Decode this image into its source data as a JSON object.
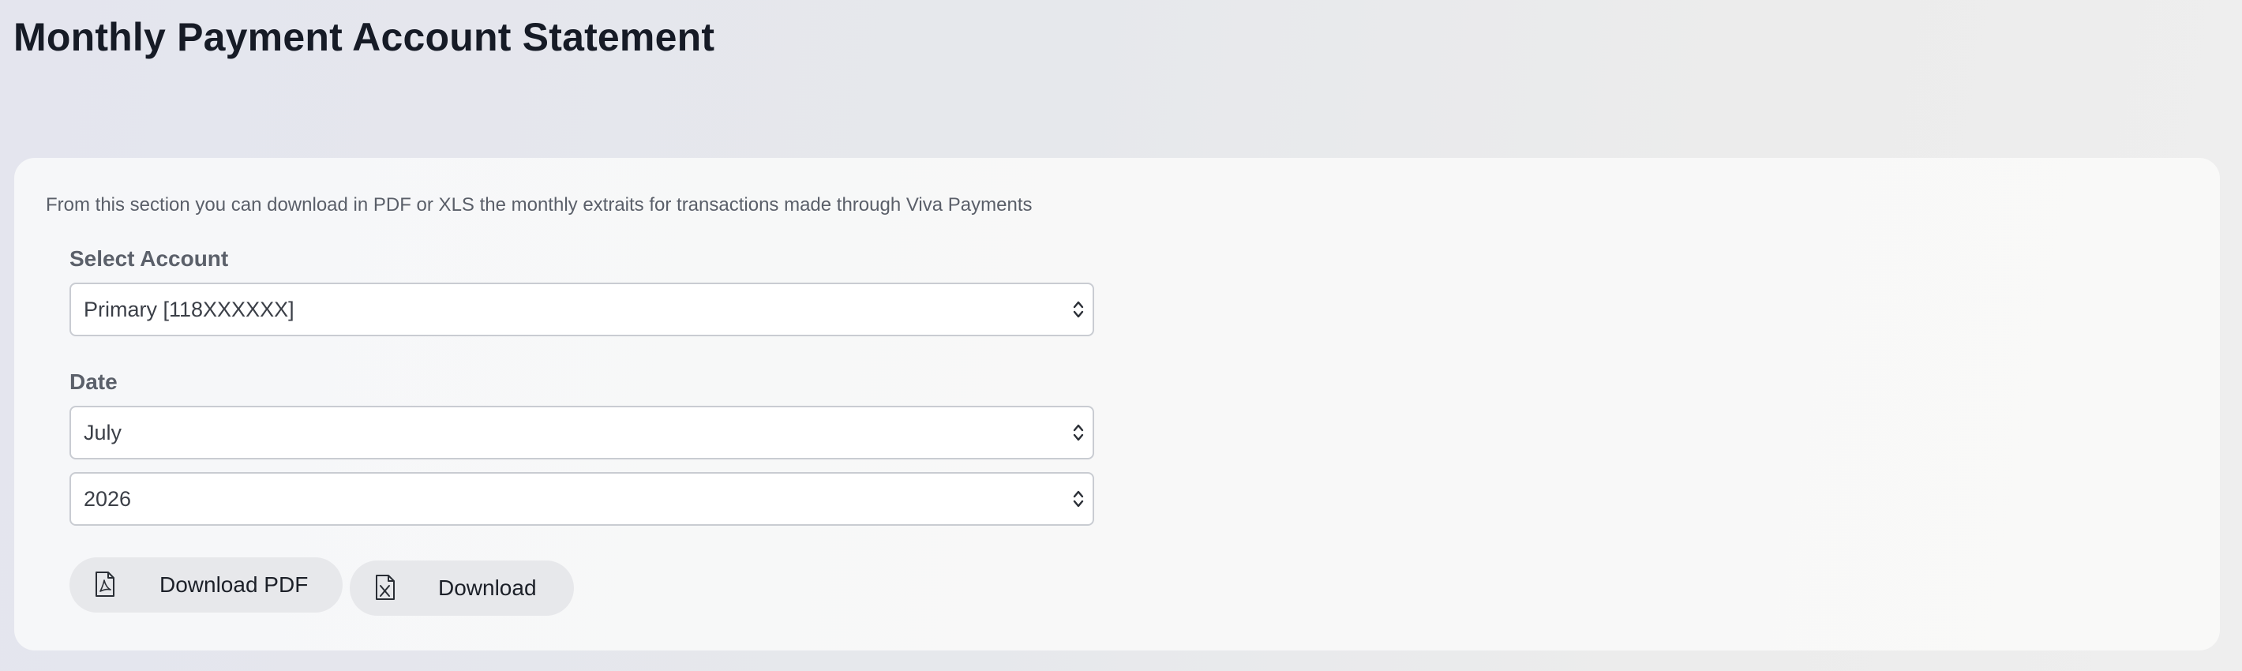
{
  "page": {
    "title": "Monthly Payment Account Statement"
  },
  "statement": {
    "description": "From this section you can download in PDF or XLS the monthly extraits for transactions made through Viva Payments",
    "account": {
      "label": "Select Account",
      "selected": "Primary [118XXXXXX]"
    },
    "date": {
      "label": "Date",
      "month_selected": "July",
      "year_selected": "2026"
    },
    "actions": {
      "download_pdf_label": "Download PDF",
      "download_pdf_icon": "pdf-file-icon",
      "download_xls_label": "Download",
      "download_xls_icon": "excel-file-icon"
    }
  },
  "colors": {
    "text_dark": "#161b26",
    "text_muted": "#5b606a",
    "button_bg": "#e7e8eb",
    "input_border": "#c9ccd2"
  }
}
